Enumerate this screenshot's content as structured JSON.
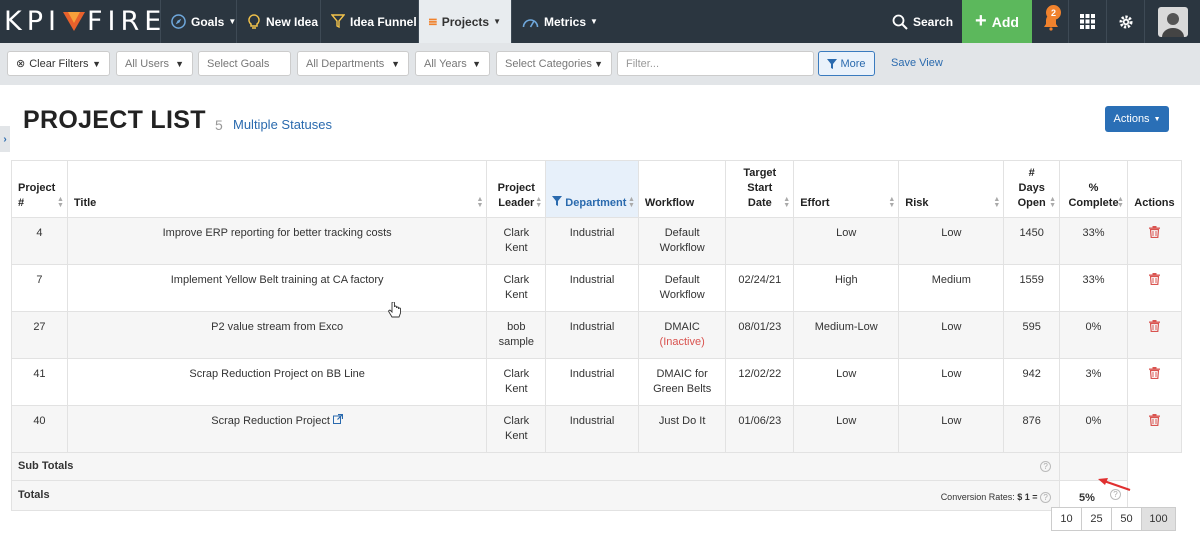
{
  "nav": {
    "logo_left": "KPI",
    "logo_right": "FIRE",
    "items": [
      {
        "label": "Goals",
        "caret": "▾"
      },
      {
        "label": "New Idea"
      },
      {
        "label": "Idea Funnel"
      },
      {
        "label": "Projects",
        "caret": "▾"
      },
      {
        "label": "Metrics",
        "caret": "▾"
      }
    ],
    "search_label": "Search",
    "add_label": "Add",
    "notifications_count": "2"
  },
  "filters": {
    "clear": "Clear Filters",
    "users": "All Users",
    "goals": "Select Goals",
    "departments": "All Departments",
    "years": "All Years",
    "categories": "Select Categories",
    "filter_placeholder": "Filter...",
    "more": "More",
    "save_view": "Save View"
  },
  "page": {
    "title": "PROJECT LIST",
    "count": "5",
    "statuses": "Multiple Statuses",
    "actions": "Actions"
  },
  "table": {
    "headers": {
      "project_num": [
        "Project",
        "#"
      ],
      "title": "Title",
      "leader": [
        "Project",
        "Leader"
      ],
      "department": "Department",
      "workflow": "Workflow",
      "target": [
        "Target",
        "Start",
        "Date"
      ],
      "effort": "Effort",
      "risk": "Risk",
      "days": [
        "#",
        "Days",
        "Open"
      ],
      "complete": [
        "%",
        "Complete"
      ],
      "actions": "Actions"
    },
    "rows": [
      {
        "id": "4",
        "title": "Improve ERP reporting for better tracking costs",
        "leader": [
          "Clark",
          "Kent"
        ],
        "department": "Industrial",
        "workflow": [
          "Default",
          "Workflow"
        ],
        "target": "",
        "effort": "Low",
        "risk": "Low",
        "days": "1450",
        "complete": "33%"
      },
      {
        "id": "7",
        "title": "Implement Yellow Belt training at CA factory",
        "leader": [
          "Clark",
          "Kent"
        ],
        "department": "Industrial",
        "workflow": [
          "Default",
          "Workflow"
        ],
        "target": "02/24/21",
        "effort": "High",
        "risk": "Medium",
        "days": "1559",
        "complete": "33%"
      },
      {
        "id": "27",
        "title": "P2 value stream from Exco",
        "leader": [
          "bob",
          "sample"
        ],
        "department": "Industrial",
        "workflow": [
          "DMAIC",
          "(Inactive)"
        ],
        "target": "08/01/23",
        "effort": "Medium-Low",
        "risk": "Low",
        "days": "595",
        "complete": "0%"
      },
      {
        "id": "41",
        "title": "Scrap Reduction Project on BB Line",
        "leader": [
          "Clark",
          "Kent"
        ],
        "department": "Industrial",
        "workflow": [
          "DMAIC for",
          "Green Belts"
        ],
        "target": "12/02/22",
        "effort": "Low",
        "risk": "Low",
        "days": "942",
        "complete": "3%"
      },
      {
        "id": "40",
        "title": "Scrap Reduction Project",
        "leader": [
          "Clark",
          "Kent"
        ],
        "department": "Industrial",
        "workflow": [
          "Just Do It",
          ""
        ],
        "target": "01/06/23",
        "effort": "Low",
        "risk": "Low",
        "days": "876",
        "complete": "0%"
      }
    ],
    "subtotals_label": "Sub Totals",
    "totals_label": "Totals",
    "conversion_label": "Conversion Rates:",
    "conversion_value": "$ 1 =",
    "total_complete": "5%"
  },
  "pagination": [
    "10",
    "25",
    "50",
    "100"
  ],
  "colors": {
    "nav_bg": "#2b3640",
    "add_green": "#5cb85c",
    "accent_blue": "#2a6aae",
    "danger_red": "#d9534f",
    "badge_orange": "#f0822d"
  }
}
